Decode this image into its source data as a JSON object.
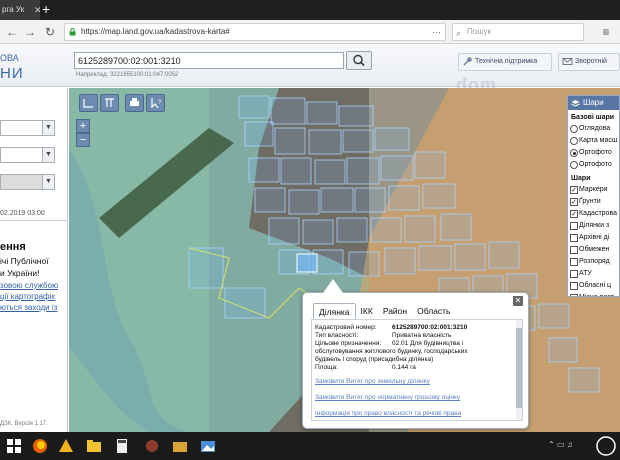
{
  "browser": {
    "tab_title": "рга  Ук",
    "tab_close": "✕",
    "new_tab": "+",
    "url": "https://map.land.gov.ua/kadastrova-karta#",
    "url_menu": "···",
    "search_placeholder": "Пошук",
    "menu_icon": "≡"
  },
  "header": {
    "logo_line1": "ОВА",
    "logo_line2": "НИ",
    "cadastral_number": "6125289700:02:001:3210",
    "hint": "Наприклад: 3221655100:01:047:0052",
    "btn_support": "Технічна підтримка",
    "btn_feedback": "Зворотній",
    "watermark": "dom"
  },
  "left_panel": {
    "date": "02.2019 03:00",
    "title": "ення",
    "line1": "ічі Публічної",
    "line2": "и України!",
    "link1": "зовою службою",
    "link2": "ції картографіє",
    "link3": "ються заходи із",
    "version": "ДЗК. Версія 1.17."
  },
  "layers": {
    "title": "Шари",
    "base_title": "Базові шари",
    "base": [
      {
        "label": "Оглядова",
        "on": false
      },
      {
        "label": "Карта масш",
        "on": false
      },
      {
        "label": "Ортофото",
        "on": true
      },
      {
        "label": "Ортофото",
        "on": false
      }
    ],
    "layers_title": "Шари",
    "items": [
      {
        "label": "Маркери",
        "on": true
      },
      {
        "label": "Ґрунти",
        "on": true
      },
      {
        "label": "Кадастрова",
        "on": true
      },
      {
        "label": "Ділянки з",
        "on": false
      },
      {
        "label": "Архівні ді",
        "on": false
      },
      {
        "label": "Обмежен",
        "on": false
      },
      {
        "label": "Розпоряд",
        "on": false
      },
      {
        "label": "АТУ",
        "on": false
      },
      {
        "label": "Обласні ц",
        "on": false
      },
      {
        "label": "Місце розт",
        "on": false
      }
    ]
  },
  "popup": {
    "tabs": [
      "Ділянка",
      "ІКК",
      "Район",
      "Область"
    ],
    "close": "✕",
    "label_number": "Кадастровий номер:",
    "value_number": "6125289700:02:001:3210",
    "label_ownership": "Тип власності:",
    "value_ownership": "Приватна власність",
    "label_purpose": "Цільове призначення:",
    "value_purpose_1": "02.01 Для будівництва і",
    "value_purpose_2": "обслуговування житлового будинку, господарських",
    "value_purpose_3": "будівель і споруд (присадибна ділянка)",
    "label_area": "Площа:",
    "value_area": "0.144 га",
    "link_extract": "Замовити Витяг про земельну ділянку",
    "link_valuation": "Замовити Витяг про нормативну грошову оцінку",
    "link_rights": "Інформація про право власності та речові права"
  },
  "colors": {
    "cyan_overlay": "#8fe0d6",
    "orange_overlay": "#f2a95c",
    "popup_border": "#a3adba",
    "accent_blue": "#5876a3",
    "link_blue": "#3361a8"
  }
}
